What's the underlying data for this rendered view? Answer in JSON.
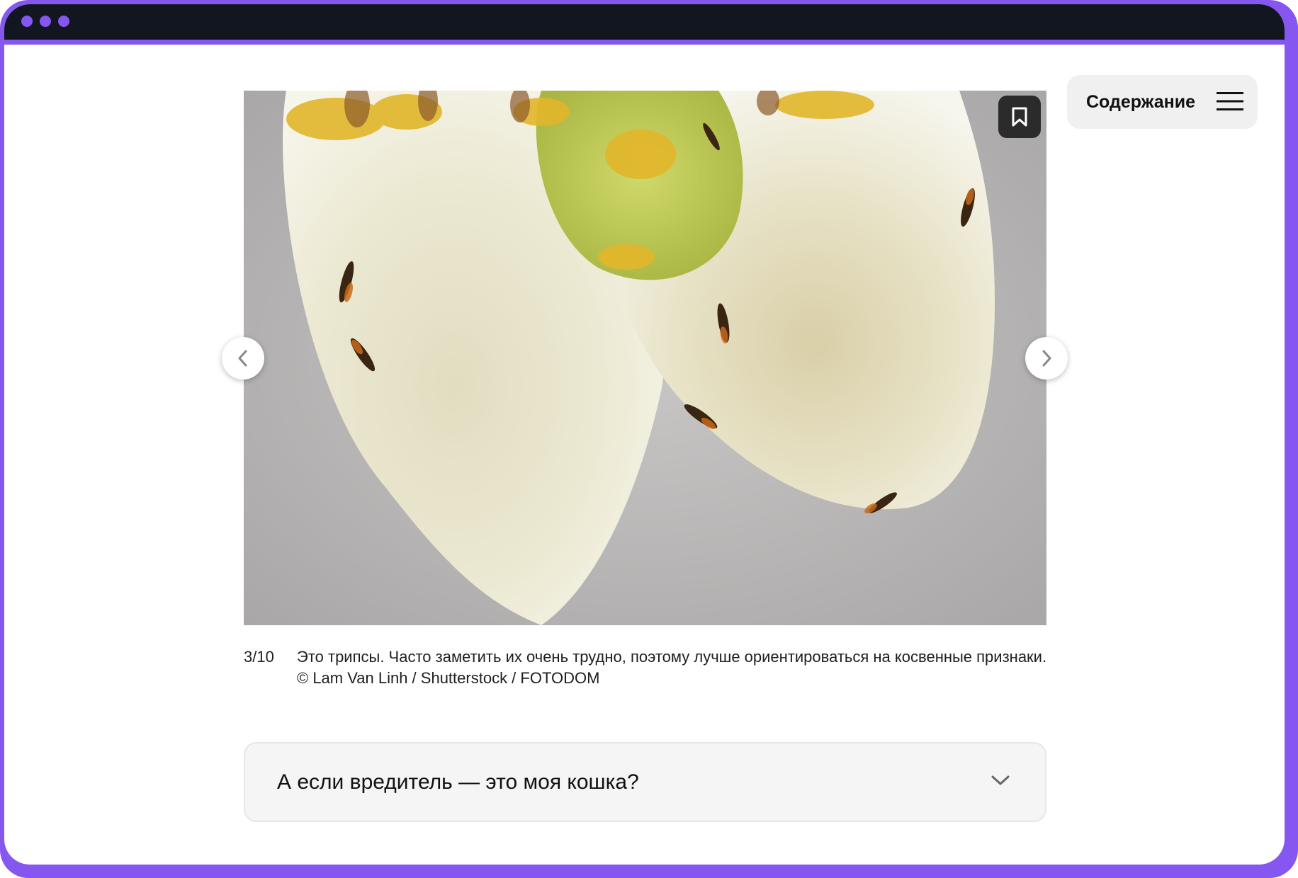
{
  "window": {
    "dot_color": "#8656f0",
    "titlebar_color": "#121620",
    "frame_color": "#8656f0"
  },
  "toc": {
    "label": "Содержание",
    "icon": "hamburger-menu-icon"
  },
  "gallery": {
    "image_alt": "thrips on white petals",
    "bookmark_icon": "bookmark-icon",
    "prev_icon": "chevron-left-icon",
    "next_icon": "chevron-right-icon",
    "counter": "3/10",
    "caption": "Это трипсы. Часто заметить их очень трудно, поэтому лучше ориентироваться на косвенные признаки. © Lam Van Linh / Shutterstock / FOTODOM"
  },
  "faq": {
    "title": "А если вредитель — это моя кошка?",
    "icon": "chevron-down-icon"
  }
}
